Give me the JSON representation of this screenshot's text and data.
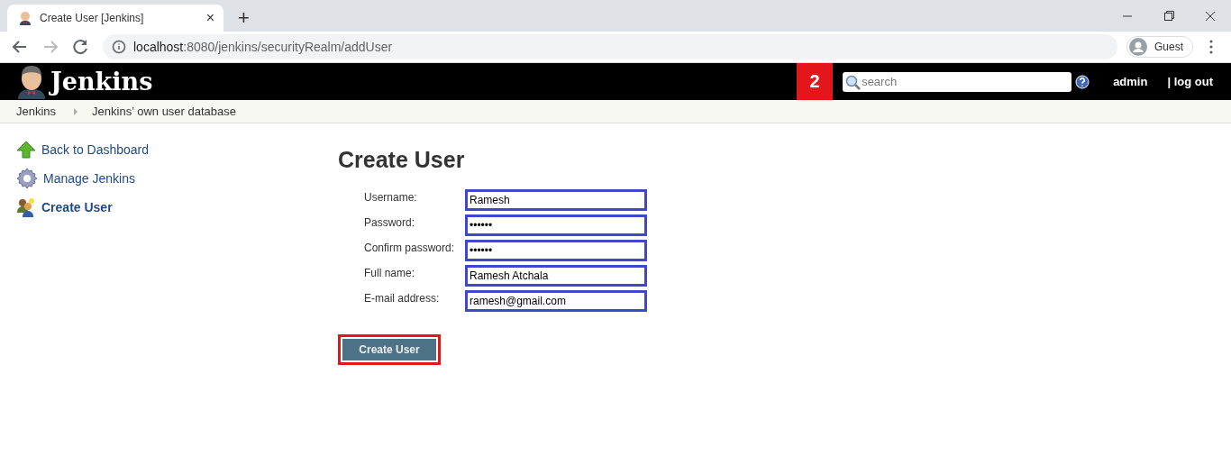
{
  "browser": {
    "tab_title": "Create User [Jenkins]",
    "tab_close": "×",
    "new_tab": "+",
    "url_host": "localhost",
    "url_rest": ":8080/jenkins/securityRealm/addUser",
    "profile": "Guest"
  },
  "header": {
    "logo_text": "Jenkins",
    "step_badge": "2",
    "search": {
      "placeholder": "search"
    },
    "user": "admin",
    "logout": "| log out"
  },
  "breadcrumbs": [
    {
      "label": "Jenkins"
    },
    {
      "label": "Jenkins’ own user database"
    }
  ],
  "sidebar": {
    "items": [
      {
        "label": "Back to Dashboard",
        "kind": "arrow",
        "selected": false
      },
      {
        "label": "Manage Jenkins",
        "kind": "gear",
        "selected": false
      },
      {
        "label": "Create User",
        "kind": "users",
        "selected": true
      }
    ]
  },
  "form": {
    "title": "Create User",
    "fields": [
      {
        "label": "Username:",
        "value": "Ramesh"
      },
      {
        "label": "Password:",
        "value": "••••••"
      },
      {
        "label": "Confirm password:",
        "value": "••••••"
      },
      {
        "label": "Full name:",
        "value": "Ramesh Atchala"
      },
      {
        "label": "E-mail address:",
        "value": "ramesh@gmail.com"
      }
    ],
    "submit": "Create User"
  }
}
